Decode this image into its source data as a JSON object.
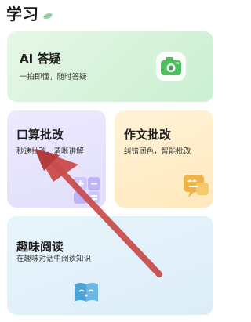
{
  "header": {
    "title": "学习",
    "leaf_icon": "leaf-icon"
  },
  "cards": {
    "ai": {
      "title": "AI 答疑",
      "subtitle": "一拍即懂，随时答疑",
      "icon": "camera-icon"
    },
    "math": {
      "title": "口算批改",
      "subtitle": "秒速批改，清晰讲解",
      "icon": "calculator-icon"
    },
    "essay": {
      "title": "作文批改",
      "subtitle": "纠错润色，智能批改",
      "icon": "chat-bubble-icon"
    },
    "reading": {
      "title": "趣味阅读",
      "subtitle": "在趣味对话中阅读知识",
      "icon": "open-book-icon"
    }
  },
  "overlay": {
    "annotation": "red-arrow-pointing-to-math-card",
    "color": "#c94b4b"
  },
  "colors": {
    "ai_green": "#4ebf5f",
    "math_purple": "#b9b2f4",
    "essay_orange": "#f1b245",
    "reading_blue": "#4aa3d9"
  }
}
